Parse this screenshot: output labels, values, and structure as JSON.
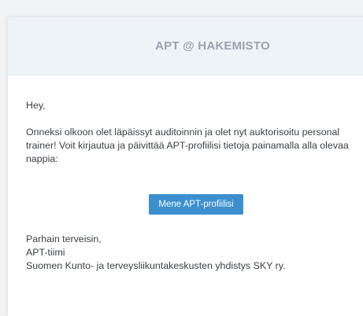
{
  "header": {
    "title": "APT @ HAKEMISTO"
  },
  "email": {
    "greeting": "Hey,",
    "message": "Onneksi olkoon olet läpäissyt auditoinnin ja olet nyt auktorisoitu personal trainer! Voit kirjautua ja päivittää APT-profiilisi tietoja painamalla alla olevaa nappia:",
    "button_label": "Mene APT-profiilisi",
    "signature": {
      "closing": "Parhain terveisin,",
      "team": "APT-tiimi",
      "organization": "Suomen Kunto- ja terveysliikuntakeskusten yhdistys SKY ry."
    }
  },
  "colors": {
    "button": "#3b8fcf",
    "header_bg": "#eef3f8",
    "header_text": "#9aa3ad"
  }
}
